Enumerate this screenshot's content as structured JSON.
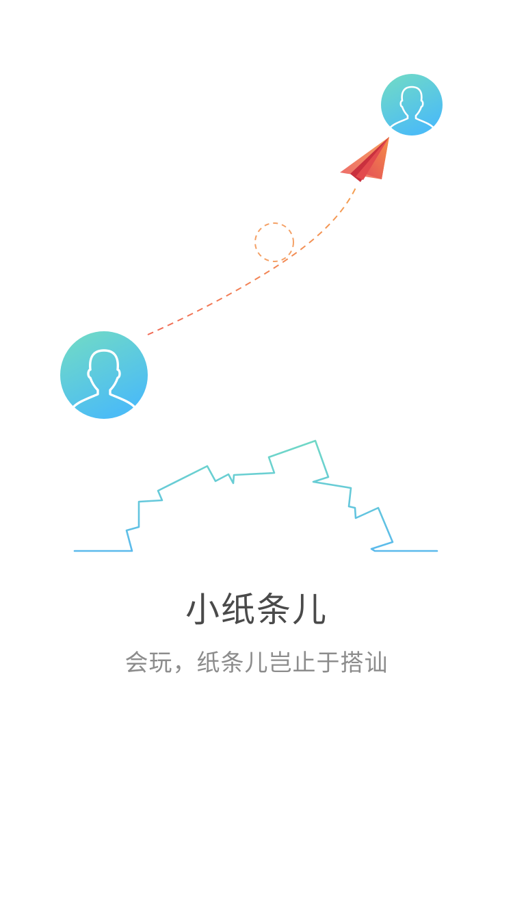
{
  "onboarding": {
    "title": "小纸条儿",
    "subtitle": "会玩，纸条儿岂止于搭讪"
  },
  "illustration": {
    "sender_avatar_icon": "user-silhouette-icon",
    "receiver_avatar_icon": "user-silhouette-icon",
    "plane_icon": "paper-plane-icon",
    "skyline_icon": "rooftop-outline-icon"
  },
  "colors": {
    "avatar_gradient_top": "#72dcc6",
    "avatar_gradient_bottom": "#4dbdf3",
    "plane_orange": "#f28a47",
    "plane_red": "#e0424e",
    "flight_path": "#f07a4c",
    "skyline_teal": "#6fd6c9",
    "skyline_blue": "#5fbdea",
    "title_text": "#4a4a4a",
    "subtitle_text": "#8c8c8c"
  }
}
